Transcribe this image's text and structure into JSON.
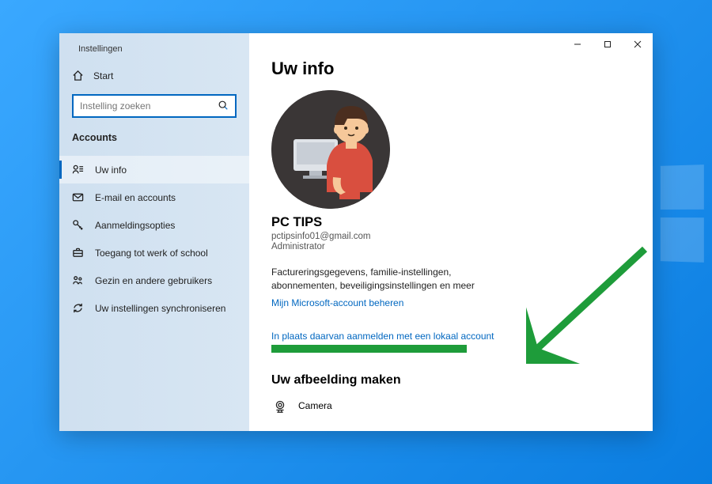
{
  "window": {
    "title": "Instellingen"
  },
  "sidebar": {
    "home": "Start",
    "search_placeholder": "Instelling zoeken",
    "group": "Accounts",
    "items": [
      {
        "label": "Uw info",
        "icon": "user-info"
      },
      {
        "label": "E-mail en accounts",
        "icon": "mail"
      },
      {
        "label": "Aanmeldingsopties",
        "icon": "key"
      },
      {
        "label": "Toegang tot werk of school",
        "icon": "briefcase"
      },
      {
        "label": "Gezin en andere gebruikers",
        "icon": "family"
      },
      {
        "label": "Uw instellingen synchroniseren",
        "icon": "sync"
      }
    ]
  },
  "main": {
    "title": "Uw info",
    "user": {
      "name": "PC TIPS",
      "email": "pctipsinfo01@gmail.com",
      "role": "Administrator"
    },
    "billing_text": "Factureringsgegevens, familie-instellingen, abonnementen, beveiligingsinstellingen en meer",
    "manage_link": "Mijn Microsoft-account beheren",
    "local_account_link": "In plaats daarvan aanmelden met een lokaal account",
    "picture_heading": "Uw afbeelding maken",
    "camera_label": "Camera"
  }
}
